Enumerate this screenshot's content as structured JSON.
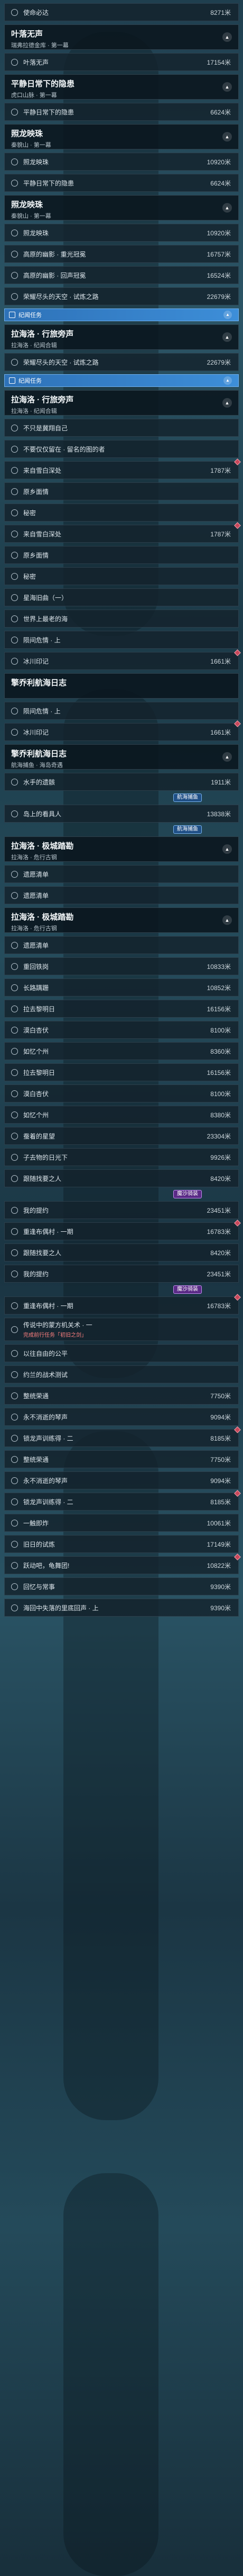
{
  "r1": {
    "t": "使命必达",
    "d": "8271米"
  },
  "h1": {
    "t": "叶落无声",
    "s": "瑞弗拉德金库 · 第一幕"
  },
  "r2": {
    "t": "叶落无声",
    "d": "17154米"
  },
  "h2": {
    "t": "平静日常下的隐患",
    "s": "虎口山脉 · 第一幕"
  },
  "r3": {
    "t": "平静日常下的隐患",
    "d": "6624米"
  },
  "h3": {
    "t": "照龙映珠",
    "s": "秦貌山 · 第一幕"
  },
  "r4": {
    "t": "照龙映珠",
    "d": "10920米"
  },
  "r5": {
    "t": "平静日常下的隐患",
    "d": "6624米"
  },
  "h4": {
    "t": "照龙映珠",
    "s": "秦貌山 · 第一幕"
  },
  "r6": {
    "t": "照龙映珠",
    "d": "10920米"
  },
  "r7": {
    "t": "高原的幽影 · 重光冠冕",
    "d": "16757米"
  },
  "r8": {
    "t": "高原的幽影 · 回声冠冕",
    "d": "16524米"
  },
  "r9": {
    "t": "荣耀尽头的天空 · 试炼之路",
    "d": "22679米"
  },
  "b1": {
    "t": "纪闻任务"
  },
  "h5": {
    "t": "拉海洛 · 行旅旁声",
    "s": "拉海洛 · 纪闻合辑"
  },
  "r10": {
    "t": "荣耀尽头的天空 · 试炼之路",
    "d": "22679米"
  },
  "b2": {
    "t": "纪闻任务"
  },
  "h6": {
    "t": "拉海洛 · 行旅旁声",
    "s": "拉海洛 · 纪闻合辑"
  },
  "r11": {
    "t": "不只是冀翔自己",
    "d": ""
  },
  "r12": {
    "t": "不要仅仅留在 · 留名的图的者",
    "d": ""
  },
  "r13": {
    "t": "来自雪白深处",
    "d": "1787米"
  },
  "r14": {
    "t": "原乡面情",
    "d": ""
  },
  "r15": {
    "t": "秘密",
    "d": ""
  },
  "r16": {
    "t": "来自雪白深处",
    "d": "1787米"
  },
  "r17": {
    "t": "原乡面情",
    "d": ""
  },
  "r18": {
    "t": "秘密",
    "d": ""
  },
  "r19": {
    "t": "星海旧曲（一）",
    "d": ""
  },
  "r20": {
    "t": "世界上最老的海",
    "d": ""
  },
  "r21": {
    "t": "陨间危情 · 上",
    "d": ""
  },
  "r22": {
    "t": "冰川印记",
    "d": "1661米"
  },
  "h7": {
    "t": "擎乔利航海日志",
    "s": ""
  },
  "r23": {
    "t": "陨间危情 · 上",
    "d": ""
  },
  "r24": {
    "t": "冰川印记",
    "d": "1661米"
  },
  "h8": {
    "t": "擎乔利航海日志",
    "s": "航海捕鱼 · 海岛奇遇"
  },
  "r25": {
    "t": "水手的遗骸",
    "d": "1911米"
  },
  "bd1": {
    "t": "航海捕鱼"
  },
  "r26": {
    "t": "岛上的看具人",
    "d": "13838米"
  },
  "bd2": {
    "t": "航海捕鱼"
  },
  "h9": {
    "t": "拉海洛 · 极城踏勘",
    "s": "拉海洛 · 危行古钢"
  },
  "r27": {
    "t": "遗愿清单",
    "d": ""
  },
  "r28": {
    "t": "遗愿清单",
    "d": ""
  },
  "h10": {
    "t": "拉海洛 · 极城踏勘",
    "s": "拉海洛 · 危行古钢"
  },
  "r29": {
    "t": "遗愿清单",
    "d": ""
  },
  "r30": {
    "t": "重回铁岗",
    "d": "10833米"
  },
  "r31": {
    "t": "长路蹒跚",
    "d": "10852米"
  },
  "r32": {
    "t": "拉去黎明日",
    "d": "16156米"
  },
  "r33": {
    "t": "漠白杏伏",
    "d": "8100米"
  },
  "r34": {
    "t": "如忆个州",
    "d": "8360米"
  },
  "r35": {
    "t": "拉去黎明日",
    "d": "16156米"
  },
  "r36": {
    "t": "漠白杏伏",
    "d": "8100米"
  },
  "r37": {
    "t": "如忆个州",
    "d": "8380米"
  },
  "r38": {
    "t": "蚕着的星望",
    "d": "23304米"
  },
  "r39": {
    "t": "子去物的日光下",
    "d": "9926米"
  },
  "r40": {
    "t": "跟随找要之人",
    "d": "8420米"
  },
  "bd3": {
    "t": "魔沙骑装"
  },
  "r41": {
    "t": "我的提约",
    "d": "23451米"
  },
  "r42": {
    "t": "重逢布偶村 · 一期",
    "d": "16783米"
  },
  "r43": {
    "t": "跟随找要之人",
    "d": "8420米"
  },
  "r44": {
    "t": "我的提约",
    "d": "23451米"
  },
  "bd4": {
    "t": "魔沙骑装"
  },
  "r45": {
    "t": "重逢布偶村 · 一期",
    "d": "16783米"
  },
  "r46": {
    "t": "传说中的蒙方机关术 · 一",
    "t2": "完成前行任务「初旧之剑」",
    "d": ""
  },
  "r47": {
    "t": "以往自由的公平",
    "d": ""
  },
  "r48": {
    "t": "约兰的战术测试",
    "d": ""
  },
  "r49": {
    "t": "整统荣通",
    "d": "7750米"
  },
  "r50": {
    "t": "永不消逝的琴声",
    "d": "9094米"
  },
  "r51": {
    "t": "锁龙声训练得 · 二",
    "d": "8185米"
  },
  "r52": {
    "t": "整统荣通",
    "d": "7750米"
  },
  "r53": {
    "t": "永不消逝的琴声",
    "d": "9094米"
  },
  "r54": {
    "t": "锁龙声训练得 · 二",
    "d": "8185米"
  },
  "r55": {
    "t": "一触即炸",
    "d": "10061米"
  },
  "r56": {
    "t": "旧日的试炼",
    "d": "17149米"
  },
  "r57": {
    "t": "跃动吧，龟舞团!",
    "d": "10822米"
  },
  "r58": {
    "t": "回忆与常事",
    "d": "9390米"
  },
  "r59": {
    "t": "海回中失落的里底回声 · 上",
    "d": "9390米"
  }
}
